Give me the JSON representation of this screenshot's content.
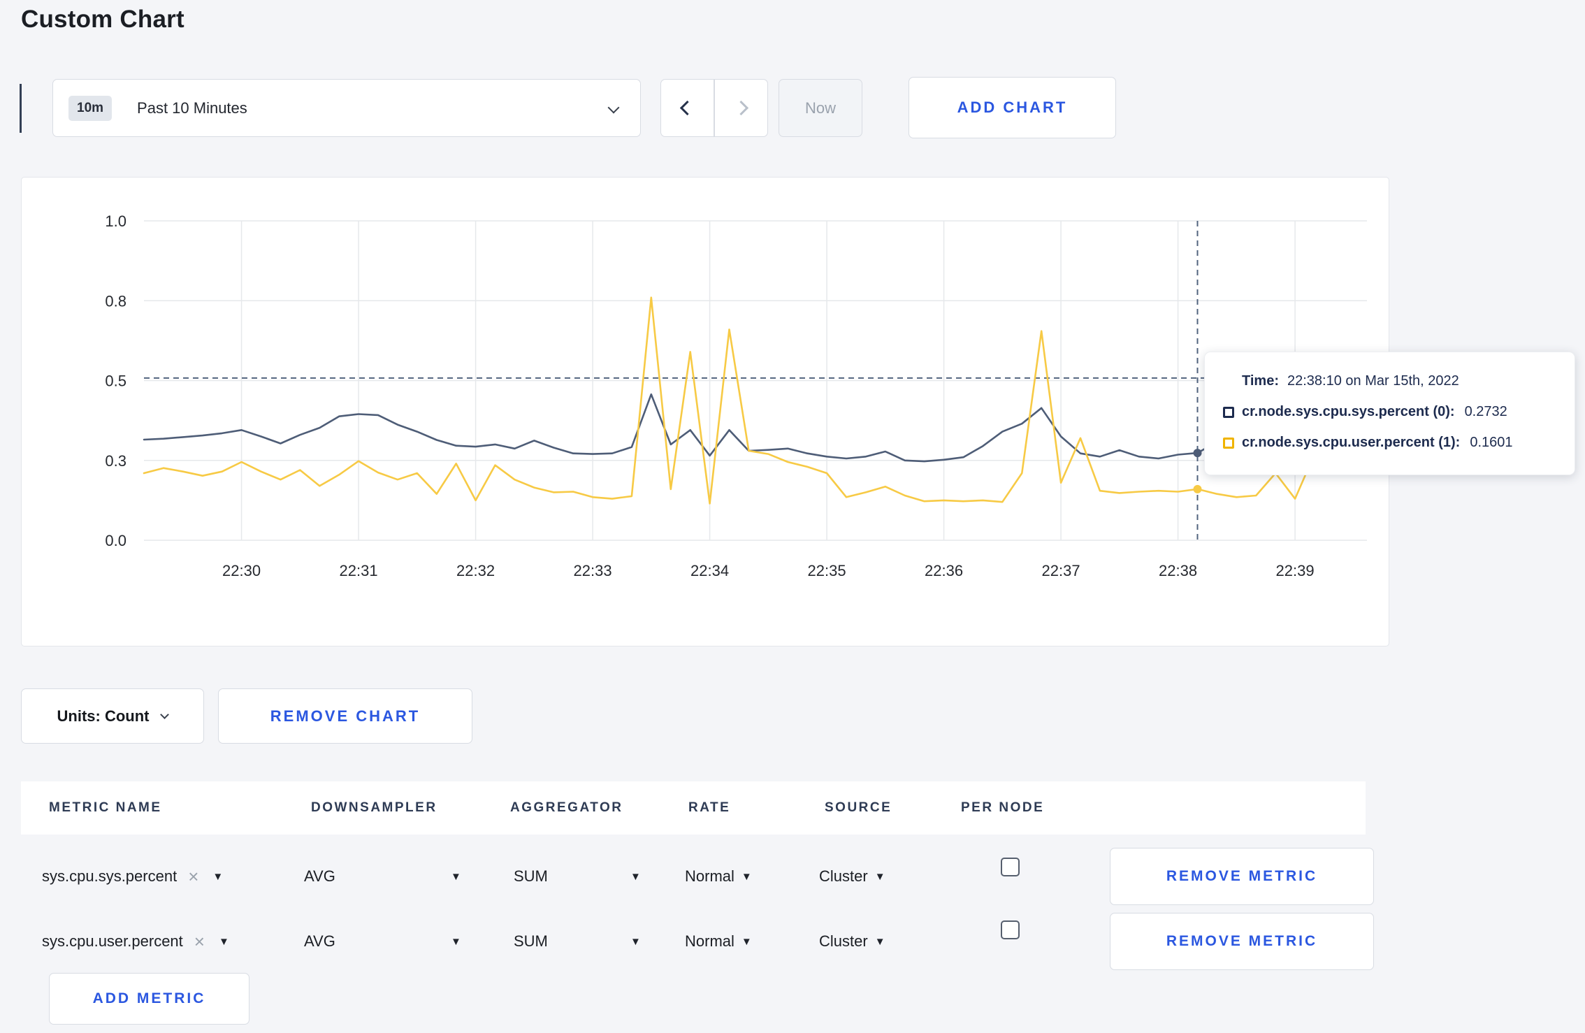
{
  "page": {
    "title": "Custom Chart"
  },
  "theme": {
    "accent": "#2b57e0",
    "navy": "#1d2b4e",
    "series_sys": "#4e5d77",
    "series_user": "#f7ca45",
    "crosshair": "#51637e",
    "grid": "#e6e8eb",
    "page_bg": "#f4f5f8",
    "border": "#d8dce3",
    "muted": "#9aa2ad"
  },
  "toolbar": {
    "time_range_badge": "10m",
    "time_range_label": "Past 10 Minutes",
    "now_label": "Now",
    "add_chart_label": "ADD CHART"
  },
  "icons": {
    "close": "×",
    "caret_down": "▼"
  },
  "tooltip": {
    "time_label": "Time:",
    "time_value": "22:38:10 on Mar 15th, 2022",
    "series": [
      {
        "name": "cr.node.sys.cpu.sys.percent (0):",
        "value": "0.2732"
      },
      {
        "name": "cr.node.sys.cpu.user.percent (1):",
        "value": "0.1601"
      }
    ]
  },
  "chart_controls": {
    "units_label": "Units: Count",
    "remove_chart_label": "REMOVE CHART"
  },
  "metrics_table": {
    "headers": [
      "METRIC NAME",
      "DOWNSAMPLER",
      "AGGREGATOR",
      "RATE",
      "SOURCE",
      "PER NODE"
    ],
    "rows": [
      {
        "metric": "sys.cpu.sys.percent",
        "downsampler": "AVG",
        "aggregator": "SUM",
        "rate": "Normal",
        "source": "Cluster",
        "per_node_checked": false,
        "remove_label": "REMOVE METRIC"
      },
      {
        "metric": "sys.cpu.user.percent",
        "downsampler": "AVG",
        "aggregator": "SUM",
        "rate": "Normal",
        "source": "Cluster",
        "per_node_checked": false,
        "remove_label": "REMOVE METRIC"
      }
    ],
    "add_metric_label": "ADD METRIC"
  },
  "chart_data": {
    "type": "line",
    "title": "",
    "x_start": "22:29:10",
    "x_end": "22:39:10",
    "x_step_seconds": 10,
    "x_ticks": [
      "22:30",
      "22:31",
      "22:32",
      "22:33",
      "22:34",
      "22:35",
      "22:36",
      "22:37",
      "22:38",
      "22:39"
    ],
    "y_axis": {
      "tick_labels": [
        "0.0",
        "0.3",
        "0.5",
        "0.8",
        "1.0"
      ],
      "tick_values": [
        0,
        0.25,
        0.5,
        0.75,
        1.0
      ],
      "range": [
        0,
        1
      ]
    },
    "grid": true,
    "legend_position": "tooltip",
    "series": [
      {
        "name": "cr.node.sys.cpu.sys.percent",
        "color": "#4e5d77",
        "values": [
          0.315,
          0.318,
          0.323,
          0.328,
          0.335,
          0.345,
          0.325,
          0.303,
          0.33,
          0.352,
          0.388,
          0.395,
          0.392,
          0.362,
          0.34,
          0.314,
          0.296,
          0.293,
          0.3,
          0.287,
          0.312,
          0.29,
          0.272,
          0.27,
          0.272,
          0.292,
          0.457,
          0.3,
          0.345,
          0.265,
          0.345,
          0.28,
          0.283,
          0.287,
          0.272,
          0.262,
          0.256,
          0.262,
          0.278,
          0.25,
          0.247,
          0.252,
          0.26,
          0.295,
          0.34,
          0.365,
          0.414,
          0.325,
          0.272,
          0.262,
          0.282,
          0.262,
          0.256,
          0.268,
          0.2732,
          0.308,
          0.285,
          0.276,
          0.3,
          0.312,
          0.3
        ]
      },
      {
        "name": "cr.node.sys.cpu.user.percent",
        "color": "#f7ca45",
        "values": [
          0.21,
          0.226,
          0.215,
          0.202,
          0.215,
          0.245,
          0.215,
          0.19,
          0.22,
          0.17,
          0.205,
          0.248,
          0.212,
          0.19,
          0.21,
          0.145,
          0.24,
          0.125,
          0.235,
          0.19,
          0.165,
          0.15,
          0.152,
          0.135,
          0.13,
          0.138,
          0.76,
          0.16,
          0.59,
          0.115,
          0.66,
          0.28,
          0.27,
          0.245,
          0.23,
          0.21,
          0.135,
          0.15,
          0.168,
          0.14,
          0.122,
          0.125,
          0.122,
          0.125,
          0.12,
          0.21,
          0.655,
          0.18,
          0.32,
          0.155,
          0.148,
          0.152,
          0.155,
          0.152,
          0.1601,
          0.145,
          0.135,
          0.14,
          0.21,
          0.13,
          0.27
        ]
      }
    ],
    "crosshair": {
      "index": 54,
      "time": "22:38:10",
      "horizontal_value": 0.508
    }
  }
}
